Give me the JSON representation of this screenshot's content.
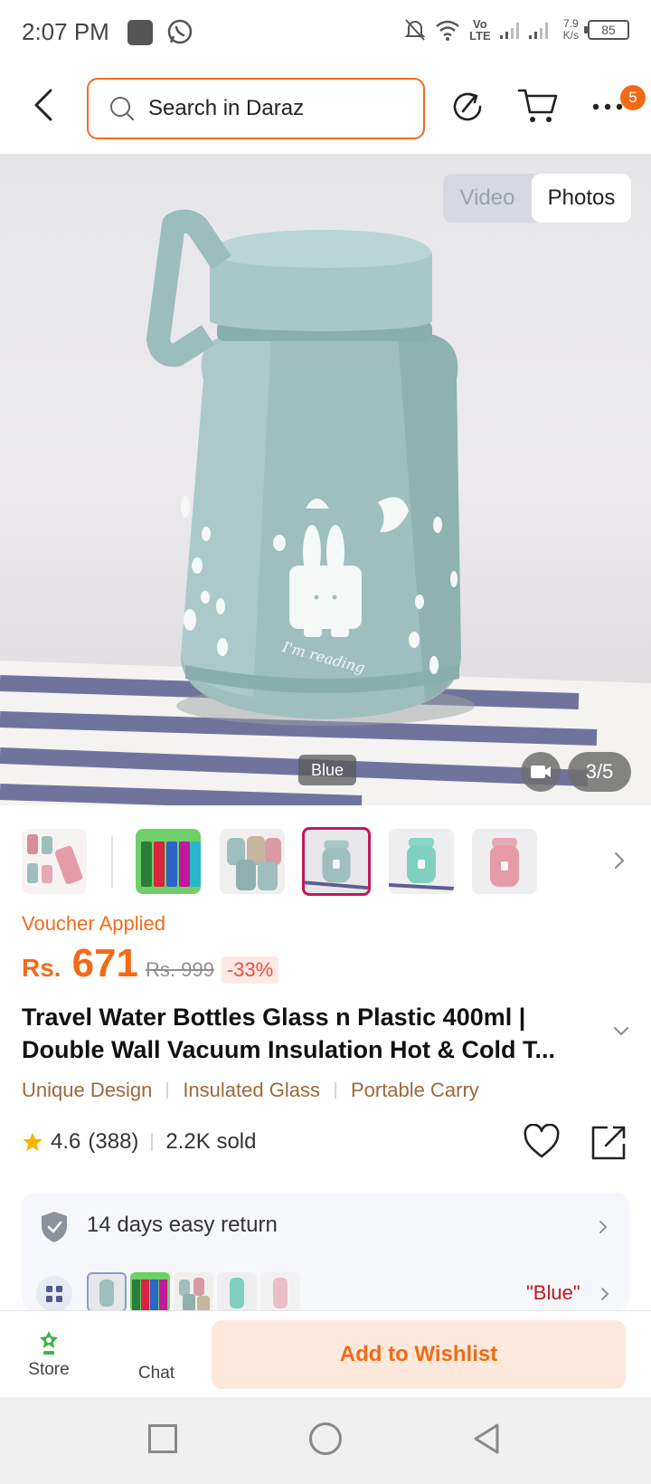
{
  "status_bar": {
    "time": "2:07 PM",
    "volte_line1": "Vo",
    "volte_line2": "LTE",
    "speed_value": "7.9",
    "speed_unit": "K/s",
    "battery": "85"
  },
  "header": {
    "search_placeholder": "Search in Daraz",
    "more_badge": "5"
  },
  "gallery": {
    "media_tabs": [
      "Video",
      "Photos"
    ],
    "active_tab": "Photos",
    "variant_tag": "Blue",
    "counter": "3/5",
    "product_text": "I'm reading"
  },
  "thumbnails": {
    "selected_index": 3,
    "items": [
      "multi-color-set",
      "glass-bottles",
      "pastel-set",
      "blue-bottle",
      "mint-bottle",
      "pink-bottle"
    ]
  },
  "price": {
    "voucher": "Voucher Applied",
    "currency": "Rs.",
    "value": "671",
    "original": "Rs. 999",
    "discount": "-33%"
  },
  "product": {
    "title_line1": "Travel Water Bottles Glass n Plastic 400ml |",
    "title_line2": "Double Wall Vacuum Insulation Hot & Cold T...",
    "tags": [
      "Unique Design",
      "Insulated Glass",
      "Portable Carry"
    ],
    "rating": "4.6",
    "reviews": "(388)",
    "sold": "2.2K sold"
  },
  "service": {
    "return_text": "14 days easy return",
    "selected_variant": "\"Blue\""
  },
  "action_bar": {
    "store_label": "Store",
    "chat_label": "Chat",
    "wishlist_label": "Add to Wishlist"
  },
  "colors": {
    "accent": "#f36a16",
    "selected_thumb": "#c2185b",
    "variant_text": "#c4171f",
    "tag_text": "#9a6a3c"
  }
}
